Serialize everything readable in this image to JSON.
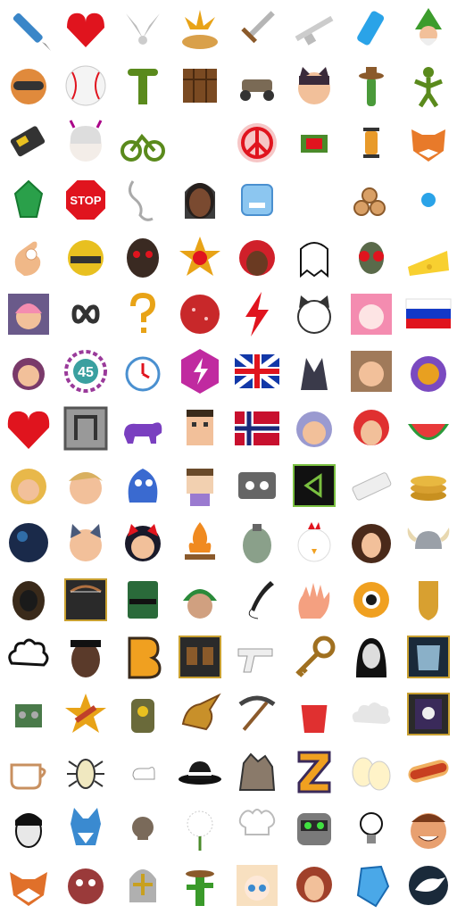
{
  "sheet": {
    "title": "",
    "icons": [
      "pen-icon",
      "pixel-heart-icon",
      "winged-emblem-icon",
      "explosion-cake-icon",
      "sword-icon",
      "rifle-icon",
      "usb-stick-icon",
      "wizard-gnome-icon",
      "fox-goggles-icon",
      "baseball-icon",
      "green-totem-icon",
      "crafting-table-icon",
      "kart-icon",
      "catgirl-face-icon",
      "cactus-cowboy-icon",
      "green-figure-icon",
      "phone-device-icon",
      "anime-girl-horns-icon",
      "green-bike-icon",
      "empty-slot",
      "peace-sign-icon",
      "pixel-hand-thumbs-icon",
      "lantern-icon",
      "pixel-fox-icon",
      "green-gem-icon",
      "stop-sign-icon",
      "hook-rope-icon",
      "woman-portrait-icon",
      "ice-cube-face-icon",
      "empty-slot",
      "logs-icon",
      "blue-skull-icon",
      "ok-hand-icon",
      "yellow-helmet-icon",
      "dark-mask-icon",
      "hearts-star-icon",
      "red-hair-portrait-icon",
      "pixel-ghost-icon",
      "alien-fly-icon",
      "cheese-icon",
      "anime-girl-purple-icon",
      "infinity-icon",
      "question-mark-icon",
      "salami-icon",
      "lightning-icon",
      "cat-face-icon",
      "pink-hair-girl-icon",
      "russia-flag-icon",
      "witch-girl-icon",
      "timer-45-icon",
      "stopwatch-icon",
      "pink-lightning-icon",
      "uk-flag-icon",
      "dark-hands-icon",
      "brown-hair-girl-icon",
      "pumpkin-icon",
      "pixel-red-heart-icon",
      "gray-block-icon",
      "purple-dog-icon",
      "pixel-man-icon",
      "norway-flag-icon",
      "purple-hair-face-icon",
      "red-hair-girl-icon",
      "watermelon-icon",
      "blonde-girl-icon",
      "blonde-boy-icon",
      "blue-creature-icon",
      "pixel-kid-icon",
      "cassette-player-icon",
      "green-triangle-icon",
      "eraser-icon",
      "coins-icon",
      "dark-planet-icon",
      "cat-kid-icon",
      "black-hair-girl-icon",
      "campfire-icon",
      "grenade-icon",
      "chicken-face-icon",
      "curly-woman-icon",
      "viking-helmet-icon",
      "dark-hood-icon",
      "bow-icon",
      "green-book-icon",
      "green-cap-character-icon",
      "quill-icon",
      "waving-hand-icon",
      "gold-ring-icon",
      "gold-shield-icon",
      "pixel-cloud-face-icon",
      "bearded-man-icon",
      "letter-b-icon",
      "boots-icon",
      "pistol-icon",
      "key-icon",
      "long-hair-portrait-icon",
      "armor-icon",
      "green-robot-icon",
      "wrench-star-icon",
      "backpack-icon",
      "dragon-head-icon",
      "pickaxe-icon",
      "red-cup-icon",
      "gray-cloud-icon",
      "skull-book-icon",
      "coffee-cup-icon",
      "bug-icon",
      "white-dog-icon",
      "fedora-icon",
      "rock-creature-icon",
      "letter-z-icon",
      "eggs-icon",
      "hotdog-icon",
      "man-portrait-icon",
      "blue-wolf-icon",
      "small-skull-icon",
      "dandelion-icon",
      "chef-hat-icon",
      "robot-head-icon",
      "lightbulb-icon",
      "smiling-man-icon",
      "fox-head-icon",
      "zombie-face-icon",
      "knight-helmet-icon",
      "cactus-hat-icon",
      "anime-portrait-icon",
      "red-hair-woman-icon",
      "blue-crystal-icon",
      "crow-icon"
    ],
    "texts": {
      "stop": "STOP",
      "timer": "45",
      "letter_b": "B",
      "letter_z": "Z"
    },
    "colors": {
      "red": "#e0141e",
      "green": "#5a8a1c",
      "gold": "#e8a317",
      "blue": "#2aa3e8",
      "brown": "#8b5a2b",
      "skin": "#f2c09a",
      "purple": "#7a3fb0",
      "pink": "#f48cb0",
      "gray": "#9a9a9a",
      "dark": "#2a2a2a"
    }
  }
}
